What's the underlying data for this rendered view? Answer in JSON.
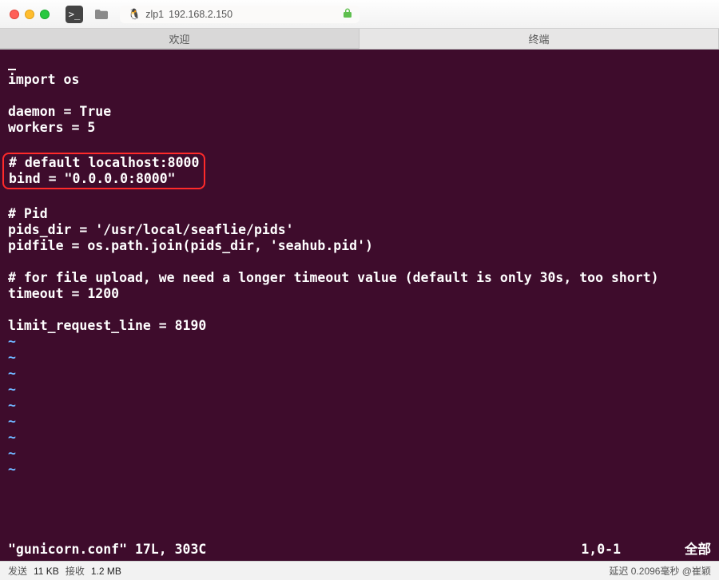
{
  "titlebar": {
    "host_user": "zlp1",
    "host_ip": "192.168.2.150"
  },
  "tabs": {
    "welcome": "欢迎",
    "terminal": "终端"
  },
  "editor": {
    "line1": "import os",
    "line2": "daemon = True",
    "line3": "workers = 5",
    "hl1": "# default localhost:8000",
    "hl2": "bind = \"0.0.0.0:8000\"",
    "line4": "# Pid",
    "line5": "pids_dir = '/usr/local/seaflie/pids'",
    "line6": "pidfile = os.path.join(pids_dir, 'seahub.pid')",
    "line7": "# for file upload, we need a longer timeout value (default is only 30s, too short)",
    "line8": "timeout = 1200",
    "line9": "limit_request_line = 8190"
  },
  "vim": {
    "file": "\"gunicorn.conf\" 17L, 303C",
    "pos": "1,0-1",
    "pct": "全部"
  },
  "status": {
    "send_label": "发送",
    "send_val": "11 KB",
    "recv_label": "接收",
    "recv_val": "1.2 MB",
    "latency": "延迟 0.2096毫秒 @崔颖"
  }
}
